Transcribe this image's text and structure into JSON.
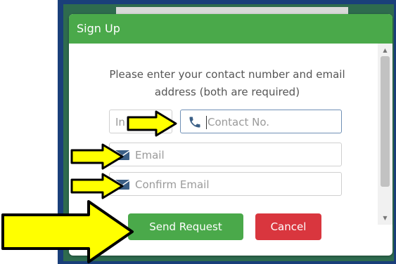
{
  "modal": {
    "title": "Sign Up",
    "instructions": "Please enter your contact number and email address (both are required)"
  },
  "form": {
    "country_code_value": "In",
    "contact_placeholder": "Contact No.",
    "email_placeholder": "Email",
    "confirm_email_placeholder": "Confirm Email"
  },
  "buttons": {
    "send_label": "Send Request",
    "cancel_label": "Cancel"
  },
  "colors": {
    "header_green": "#4aa94a",
    "send_green": "#4aa94a",
    "cancel_red": "#d9363e",
    "arrow_yellow": "#ffff00",
    "backdrop_blue": "#1a3f7a"
  },
  "icons": {
    "phone": "phone-icon",
    "email": "envelope-icon",
    "arrow": "yellow-arrow-pointer"
  }
}
